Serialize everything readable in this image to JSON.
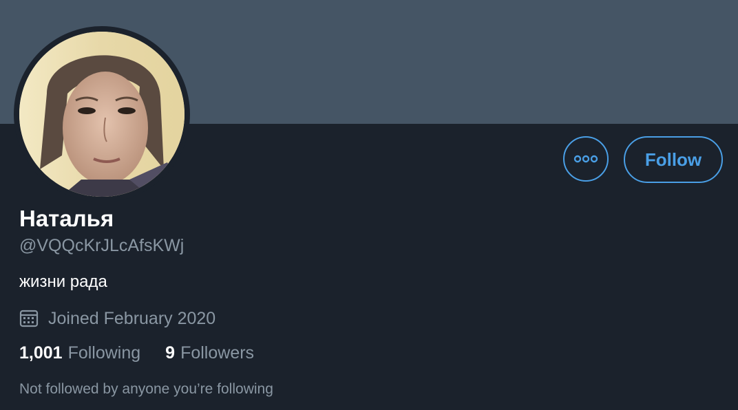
{
  "profile": {
    "display_name": "Наталья",
    "handle": "@VQQcKrJLcAfsKWj",
    "bio": "жизни рада",
    "joined": "Joined February 2020",
    "mutuals_note": "Not followed by anyone you’re following"
  },
  "actions": {
    "follow_label": "Follow",
    "more_icon": "more-horizontal-icon"
  },
  "stats": {
    "following_count": "1,001",
    "following_label": "Following",
    "followers_count": "9",
    "followers_label": "Followers"
  },
  "icons": {
    "joined": "calendar-icon"
  },
  "colors": {
    "background": "#1b222c",
    "banner": "#455565",
    "accent": "#4a9fe6",
    "muted_text": "#8a97a3",
    "primary_text": "#ffffff"
  }
}
